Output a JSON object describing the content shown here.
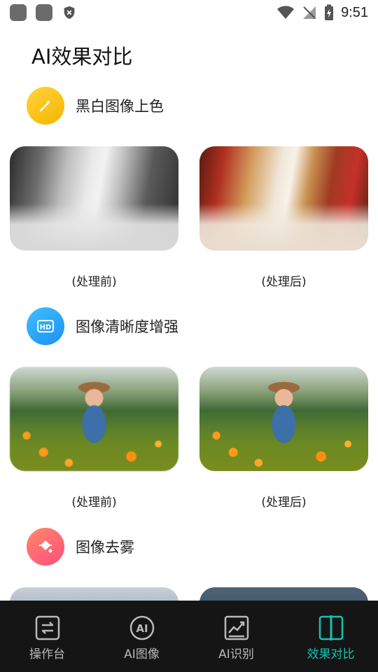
{
  "status_bar": {
    "time": "9:51"
  },
  "page_title": "AI效果对比",
  "sections": [
    {
      "label": "黑白图像上色",
      "icon": "magic-wand-icon",
      "before_caption": "(处理前)",
      "after_caption": "(处理后)"
    },
    {
      "label": "图像清晰度增强",
      "icon": "hd-icon",
      "icon_text": "HD",
      "before_caption": "(处理前)",
      "after_caption": "(处理后)"
    },
    {
      "label": "图像去雾",
      "icon": "paint-bucket-icon"
    }
  ],
  "bottom_nav": [
    {
      "label": "操作台",
      "icon": "console-icon",
      "active": false
    },
    {
      "label": "AI图像",
      "icon": "ai-image-icon",
      "icon_text": "AI",
      "active": false
    },
    {
      "label": "AI识别",
      "icon": "chart-trend-icon",
      "active": false
    },
    {
      "label": "效果对比",
      "icon": "compare-icon",
      "active": true
    }
  ],
  "colors": {
    "accent": "#14c3b0",
    "nav_background": "#151515",
    "inactive": "#b9b9b9"
  }
}
